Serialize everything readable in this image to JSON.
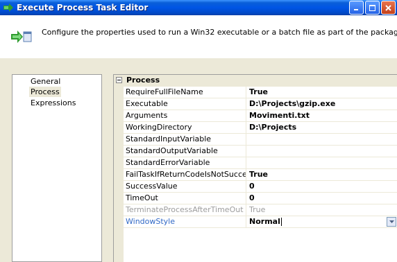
{
  "window": {
    "title": "Execute Process Task Editor",
    "colors": {
      "titlebar": "#0055e5",
      "background": "#ece9d8",
      "selected_text": "#3169c6",
      "readonly_text": "#9d9d9d"
    }
  },
  "header": {
    "description": "Configure the properties used to run a Win32 executable or a batch file as part of the package.",
    "icon": "execute-process-icon"
  },
  "nav": {
    "items": [
      {
        "label": "General",
        "selected": false
      },
      {
        "label": "Process",
        "selected": true
      },
      {
        "label": "Expressions",
        "selected": false
      }
    ]
  },
  "grid": {
    "category": "Process",
    "rows": [
      {
        "name": "RequireFullFileName",
        "value": "True"
      },
      {
        "name": "Executable",
        "value": "D:\\Projects\\gzip.exe"
      },
      {
        "name": "Arguments",
        "value": "Movimenti.txt"
      },
      {
        "name": "WorkingDirectory",
        "value": "D:\\Projects"
      },
      {
        "name": "StandardInputVariable",
        "value": ""
      },
      {
        "name": "StandardOutputVariable",
        "value": ""
      },
      {
        "name": "StandardErrorVariable",
        "value": ""
      },
      {
        "name": "FailTaskIfReturnCodeIsNotSuccessValue",
        "value": "True"
      },
      {
        "name": "SuccessValue",
        "value": "0"
      },
      {
        "name": "TimeOut",
        "value": "0"
      },
      {
        "name": "TerminateProcessAfterTimeOut",
        "value": "True",
        "readonly": true
      },
      {
        "name": "WindowStyle",
        "value": "Normal",
        "selected": true
      }
    ]
  }
}
